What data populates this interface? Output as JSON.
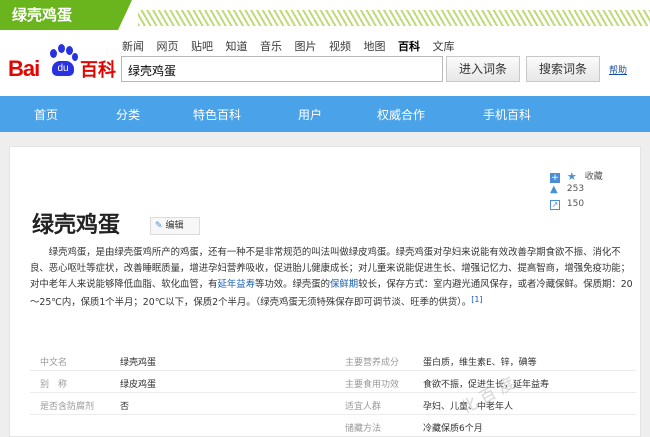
{
  "banner": {
    "tag": "绿壳鸡蛋"
  },
  "logo": {
    "bai": "Bai",
    "du": "du",
    "baike": "百科"
  },
  "top_links": [
    "新闻",
    "网页",
    "贴吧",
    "知道",
    "音乐",
    "图片",
    "视频",
    "地图",
    "百科",
    "文库"
  ],
  "top_links_active": "百科",
  "search": {
    "value": "绿壳鸡蛋",
    "enter_label": "进入词条",
    "search_label": "搜索词条",
    "help_label": "帮助"
  },
  "main_nav": [
    "首页",
    "分类",
    "特色百科",
    "用户",
    "权威合作",
    "手机百科"
  ],
  "side_tools": {
    "collect_label": "收藏",
    "like_count": "253",
    "share_count": "150"
  },
  "entry": {
    "title": "绿壳鸡蛋",
    "edit_label": "编辑",
    "summary_part1": "绿壳鸡蛋，是由绿壳蛋鸡所产的鸡蛋，还有一种不是非常规范的叫法叫做绿皮鸡蛋。绿壳鸡蛋对孕妇来说能有效改善孕期食欲不振、消化不良、恶心呕吐等症状，改善睡眠质量，增进孕妇营养吸收，促进胎儿健康成长；对儿童来说能促进生长、增强记忆力、提高智商，增强免疫功能；对中老年人来说能够降低血脂、软化血管，有",
    "summary_link1": "延年益寿",
    "summary_part2": "等功效。绿壳蛋的",
    "summary_link2": "保鲜期",
    "summary_part3": "较长，保存方式：室内避光通风保存，或者冷藏保鲜。保质期：20～25℃内，保质1个半月；20℃以下，保质2个半月。（绿壳鸡蛋无须特殊保存即可调节淡、旺季的供货）。",
    "summary_ref": "[1]"
  },
  "watermark": "化 百 度",
  "infobox": {
    "rows": [
      {
        "l1": "中文名",
        "v1": "绿壳鸡蛋",
        "l2": "主要营养成分",
        "v2": "蛋白质，维生素E、锌，碘等"
      },
      {
        "l1": "别　称",
        "v1": "绿皮鸡蛋",
        "l2": "主要食用功效",
        "v2": "食欲不振，促进生长，延年益寿"
      },
      {
        "l1": "是否含防腐剂",
        "v1": "否",
        "l2": "适宜人群",
        "v2": "孕妇、儿童、中老年人"
      },
      {
        "l1": "",
        "v1": "",
        "l2": "储藏方法",
        "v2": "冷藏保质6个月"
      }
    ]
  },
  "colors": {
    "tag_green": "#6ab41e",
    "nav_blue": "#4aa3e8",
    "logo_red": "#e10602",
    "logo_blue": "#2932e1",
    "link_blue": "#1a5fb4"
  }
}
